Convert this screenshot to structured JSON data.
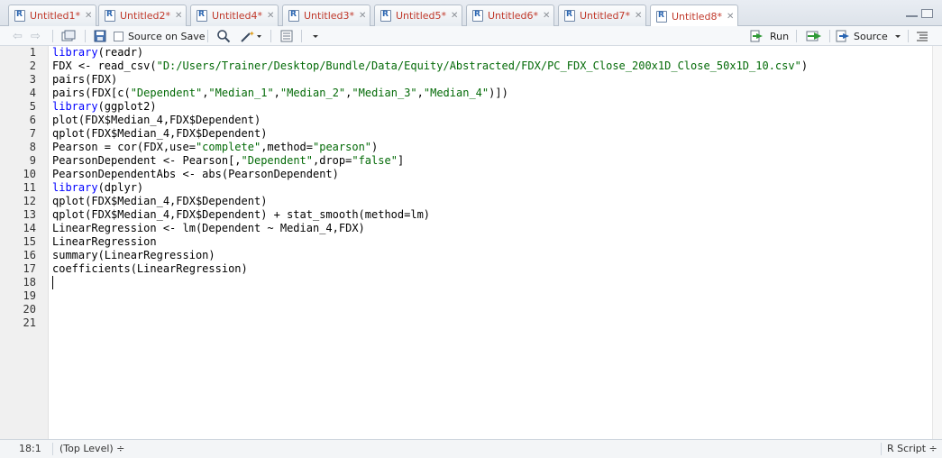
{
  "tabs": [
    {
      "label": "Untitled1*"
    },
    {
      "label": "Untitled2*"
    },
    {
      "label": "Untitled4*"
    },
    {
      "label": "Untitled3*"
    },
    {
      "label": "Untitled5*"
    },
    {
      "label": "Untitled6*"
    },
    {
      "label": "Untitled7*"
    },
    {
      "label": "Untitled8*"
    }
  ],
  "active_tab": "Untitled8*",
  "toolbar": {
    "source_on_save_label": "Source on Save",
    "run_label": "Run",
    "source_label": "Source"
  },
  "editor": {
    "line_numbers": [
      "1",
      "2",
      "3",
      "4",
      "5",
      "6",
      "7",
      "8",
      "9",
      "10",
      "11",
      "12",
      "13",
      "14",
      "15",
      "16",
      "17",
      "18",
      "19",
      "20",
      "21"
    ],
    "lines": [
      "library(readr)",
      "FDX <- read_csv(\"D:/Users/Trainer/Desktop/Bundle/Data/Equity/Abstracted/FDX/PC_FDX_Close_200x1D_Close_50x1D_10.csv\")",
      "pairs(FDX)",
      "pairs(FDX[c(\"Dependent\",\"Median_1\",\"Median_2\",\"Median_3\",\"Median_4\")])",
      "library(ggplot2)",
      "plot(FDX$Median_4,FDX$Dependent)",
      "qplot(FDX$Median_4,FDX$Dependent)",
      "Pearson = cor(FDX,use=\"complete\",method=\"pearson\")",
      "PearsonDependent <- Pearson[,\"Dependent\",drop=\"false\"]",
      "PearsonDependentAbs <- abs(PearsonDependent)",
      "library(dplyr)",
      "qplot(FDX$Median_4,FDX$Dependent)",
      "qplot(FDX$Median_4,FDX$Dependent) + stat_smooth(method=lm)",
      "LinearRegression <- lm(Dependent ~ Median_4,FDX)",
      "LinearRegression",
      "summary(LinearRegression)",
      "coefficients(LinearRegression)",
      "",
      "",
      "",
      ""
    ]
  },
  "status": {
    "cursor_position": "18:1",
    "scope": "(Top Level) ÷",
    "file_type": "R Script ÷"
  },
  "colors": {
    "tab_label": "#c0392b",
    "keyword": "#0000ff",
    "string": "#036a07"
  }
}
